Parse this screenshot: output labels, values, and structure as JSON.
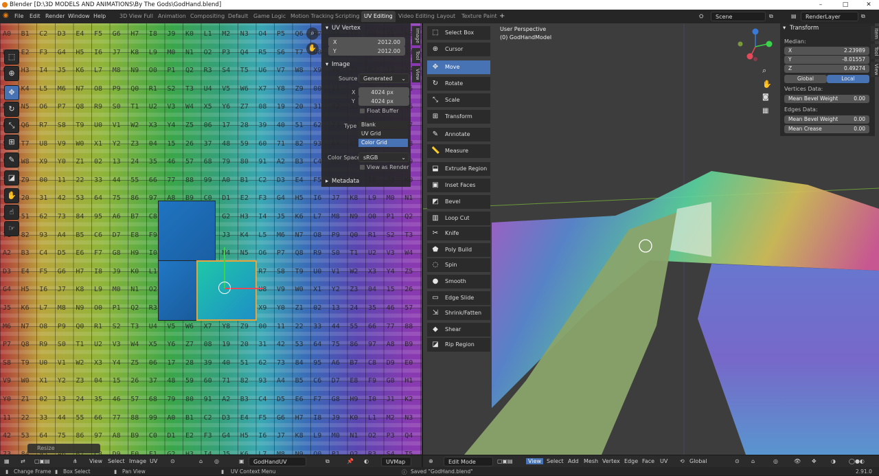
{
  "window": {
    "title": "Blender [D:\\3D MODELS AND ANIMATIONS\\By The Gods\\GodHand.blend]",
    "minimize": "–",
    "maximize": "□",
    "close": "✕"
  },
  "menu": [
    "File",
    "Edit",
    "Render",
    "Window",
    "Help"
  ],
  "workspaces": [
    "3D View Full",
    "Animation",
    "Compositing",
    "Default",
    "Game Logic",
    "Motion Tracking",
    "Scripting",
    "UV Editing",
    "Video Editing",
    "Layout",
    "Texture Paint"
  ],
  "add_workspace": "+",
  "scene": "Scene",
  "render_layer": "RenderLayer",
  "uv_panel": {
    "uv_vertex_title": "UV Vertex",
    "x_label": "X",
    "x_value": "2012.00",
    "y_label": "Y",
    "y_value": "2012.00",
    "image_title": "Image",
    "source_label": "Source",
    "source_value": "Generated",
    "img_x_label": "X",
    "img_x_value": "4024 px",
    "img_y_label": "Y",
    "img_y_value": "4024 px",
    "float_buffer": "Float Buffer",
    "type_label": "Type",
    "type_options": [
      "Blank",
      "UV Grid",
      "Color Grid"
    ],
    "color_space_label": "Color Space",
    "color_space_value": "sRGB",
    "view_as_render": "View as Render",
    "metadata_title": "Metadata"
  },
  "uv_side_tabs": [
    "Image",
    "Tool",
    "View"
  ],
  "resize_label": "Resize",
  "uv_header": {
    "view": "View",
    "select": "Select",
    "image": "Image",
    "uv": "UV",
    "image_name": "GodHandUV",
    "uvmap": "UVMap"
  },
  "viewport": {
    "perspective": "User Perspective",
    "object": "(0) GodHandModel",
    "tools": [
      "Select Box",
      "Cursor",
      "Move",
      "Rotate",
      "Scale",
      "Transform",
      "Annotate",
      "Measure",
      "Extrude Region",
      "Inset Faces",
      "Bevel",
      "Loop Cut",
      "Knife",
      "Poly Build",
      "Spin",
      "Smooth",
      "Edge Slide",
      "Shrink/Fatten",
      "Shear",
      "Rip Region"
    ],
    "active_tool": "Move",
    "tabs": [
      "Item",
      "Tool",
      "View"
    ]
  },
  "transform_panel": {
    "title": "Transform",
    "median": "Median:",
    "x_label": "X",
    "x_value": "2.23989",
    "y_label": "Y",
    "y_value": "-8.01557",
    "z_label": "Z",
    "z_value": "0.49274",
    "global": "Global",
    "local": "Local",
    "vertices_data": "Vertices Data:",
    "mean_bevel_weight_label": "Mean Bevel Weight",
    "mean_bevel_weight_v": "0.00",
    "edges_data": "Edges Data:",
    "edge_bevel_label": "Mean Bevel Weight",
    "edge_bevel_value": "0.00",
    "mean_crease_label": "Mean Crease",
    "mean_crease_value": "0.00"
  },
  "vp_header": {
    "mode": "Edit Mode",
    "view": "View",
    "select": "Select",
    "add": "Add",
    "mesh": "Mesh",
    "vertex": "Vertex",
    "edge": "Edge",
    "face": "Face",
    "uv": "UV",
    "orientation": "Global"
  },
  "status": {
    "change_frame": "Change Frame",
    "box_select": "Box Select",
    "pan_view": "Pan View",
    "uv_context": "UV Context Menu",
    "saved": "Saved \"GodHand.blend\"",
    "version": "2.91.0"
  },
  "colors": {
    "accent": "#4772b3",
    "panel": "#282828",
    "header": "#2b2b2b"
  }
}
